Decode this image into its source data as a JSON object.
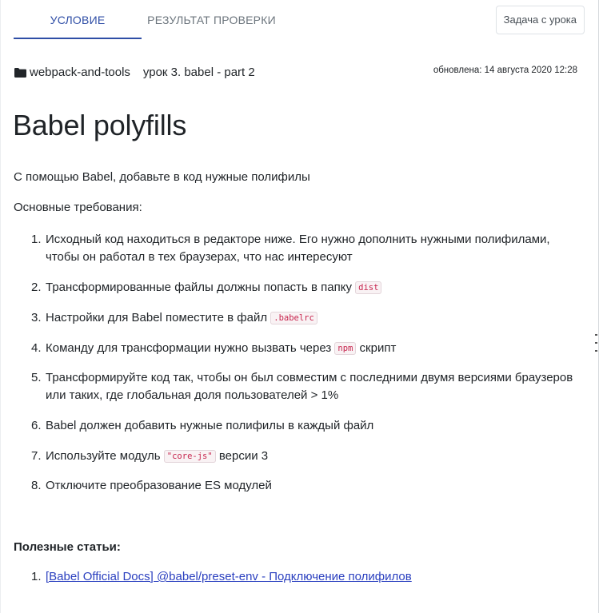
{
  "tabs": [
    {
      "label": "УСЛОВИЕ",
      "active": true
    },
    {
      "label": "РЕЗУЛЬТАТ ПРОВЕРКИ",
      "active": false
    }
  ],
  "task_button_label": "Задача с урока",
  "breadcrumb": {
    "course": "webpack-and-tools",
    "lesson": "урок 3. babel - part 2"
  },
  "updated": "обновлена: 14 августа 2020 12:28",
  "title": "Babel polyfills",
  "intro": "С помощью Babel, добавьте в код нужные полифилы",
  "requirements_label": "Основные требования:",
  "requirements": [
    {
      "n": "1.",
      "parts": [
        "Исходный код находиться в редакторе ниже. Его нужно дополнить нужными полифилами, чтобы он работал в тех браузерах, что нас интересуют"
      ]
    },
    {
      "n": "2.",
      "parts": [
        "Трансформированные файлы должны попасть в папку ",
        {
          "code": "dist"
        }
      ]
    },
    {
      "n": "3.",
      "parts": [
        "Настройки для Babel поместите в файл ",
        {
          "code": ".babelrc"
        }
      ]
    },
    {
      "n": "4.",
      "parts": [
        "Команду для трансформации нужно вызвать через ",
        {
          "code": "npm"
        },
        " скрипт"
      ]
    },
    {
      "n": "5.",
      "parts": [
        "Трансформируйте код так, чтобы он был совместим с последними двумя версиями браузеров или таких, где глобальная доля пользователей > 1%"
      ]
    },
    {
      "n": "6.",
      "parts": [
        "Babel должен добавить нужные полифилы в каждый файл"
      ]
    },
    {
      "n": "7.",
      "parts": [
        "Используйте модуль ",
        {
          "code": "\"core-js\""
        },
        " версии 3"
      ]
    },
    {
      "n": "8.",
      "parts": [
        "Отключите преобразование ES модулей"
      ]
    }
  ],
  "useful_label": "Полезные статьи:",
  "links": [
    {
      "n": "1.",
      "text": "[Babel Official Docs] @babel/preset-env - Подключение полифилов"
    }
  ],
  "colors": {
    "accent": "#2f4ea6",
    "link": "#2a3fbf",
    "code": "#c7254e"
  }
}
